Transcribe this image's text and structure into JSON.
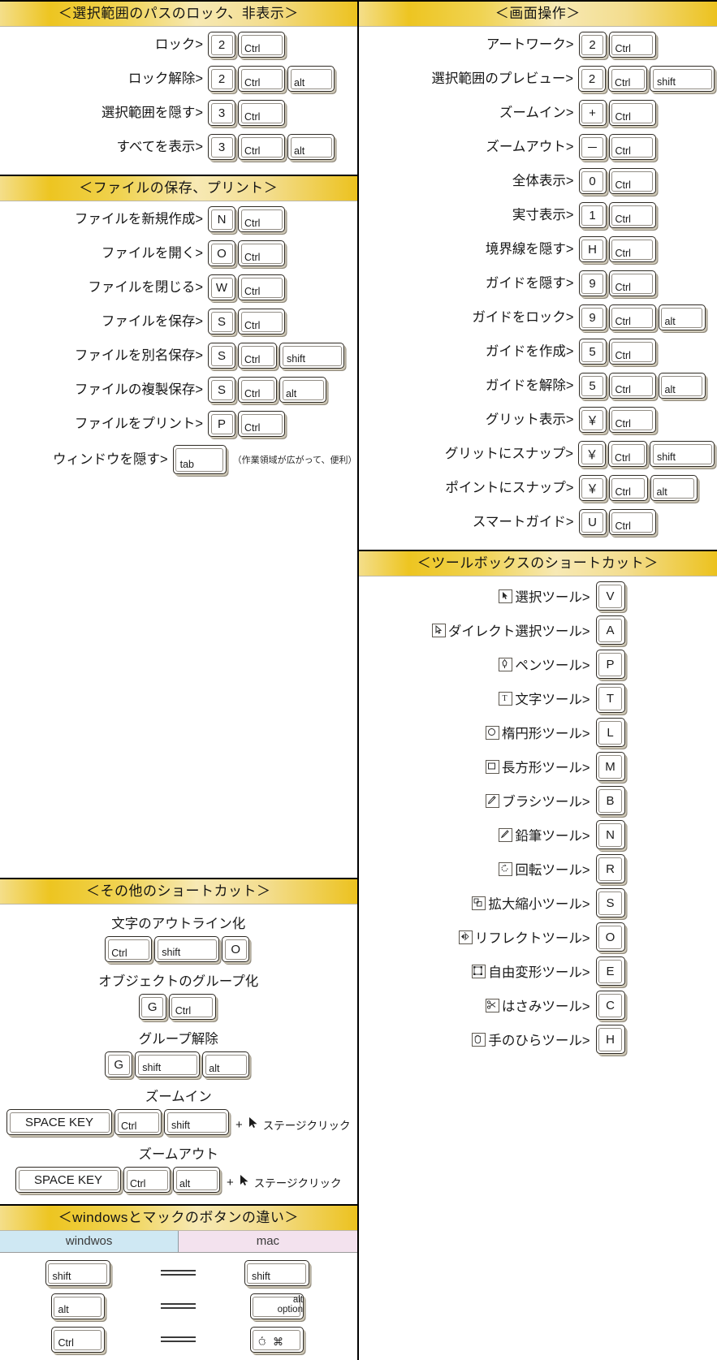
{
  "sections": {
    "lock_hide": {
      "title": "＜選択範囲のパスのロック、非表示＞",
      "rows": [
        {
          "label": "ロック>",
          "keys": [
            "2",
            "Ctrl"
          ]
        },
        {
          "label": "ロック解除>",
          "keys": [
            "2",
            "Ctrl",
            "alt"
          ]
        },
        {
          "label": "選択範囲を隠す>",
          "keys": [
            "3",
            "Ctrl"
          ]
        },
        {
          "label": "すべてを表示>",
          "keys": [
            "3",
            "Ctrl",
            "alt"
          ]
        }
      ]
    },
    "file_save_print": {
      "title": "＜ファイルの保存、プリント＞",
      "rows": [
        {
          "label": "ファイルを新規作成>",
          "keys": [
            "N",
            "Ctrl"
          ]
        },
        {
          "label": "ファイルを開く>",
          "keys": [
            "O",
            "Ctrl"
          ]
        },
        {
          "label": "ファイルを閉じる>",
          "keys": [
            "W",
            "Ctrl"
          ]
        },
        {
          "label": "ファイルを保存>",
          "keys": [
            "S",
            "Ctrl"
          ]
        },
        {
          "label": "ファイルを別名保存>",
          "keys": [
            "S",
            "Ctrl",
            "shift"
          ]
        },
        {
          "label": "ファイルの複製保存>",
          "keys": [
            "S",
            "Ctrl",
            "alt"
          ]
        },
        {
          "label": "ファイルをプリント>",
          "keys": [
            "P",
            "Ctrl"
          ]
        },
        {
          "label": "ウィンドウを隠す>",
          "keys": [
            "tab"
          ],
          "note": "（作業領域が広がって、便利）"
        }
      ]
    },
    "screen_ops": {
      "title": "＜画面操作＞",
      "rows": [
        {
          "label": "アートワーク>",
          "keys": [
            "2",
            "Ctrl"
          ]
        },
        {
          "label": "選択範囲のプレビュー>",
          "keys": [
            "2",
            "Ctrl",
            "shift"
          ]
        },
        {
          "label": "ズームイン>",
          "keys": [
            "+",
            "Ctrl"
          ]
        },
        {
          "label": "ズームアウト>",
          "keys": [
            "－",
            "Ctrl"
          ]
        },
        {
          "label": "全体表示>",
          "keys": [
            "0",
            "Ctrl"
          ]
        },
        {
          "label": "実寸表示>",
          "keys": [
            "1",
            "Ctrl"
          ]
        },
        {
          "label": "境界線を隠す>",
          "keys": [
            "H",
            "Ctrl"
          ]
        },
        {
          "label": "ガイドを隠す>",
          "keys": [
            "9",
            "Ctrl"
          ]
        },
        {
          "label": "ガイドをロック>",
          "keys": [
            "9",
            "Ctrl",
            "alt"
          ]
        },
        {
          "label": "ガイドを作成>",
          "keys": [
            "5",
            "Ctrl"
          ]
        },
        {
          "label": "ガイドを解除>",
          "keys": [
            "5",
            "Ctrl",
            "alt"
          ]
        },
        {
          "label": "グリット表示>",
          "keys": [
            "￥",
            "Ctrl"
          ]
        },
        {
          "label": "グリットにスナップ>",
          "keys": [
            "￥",
            "Ctrl",
            "shift"
          ]
        },
        {
          "label": "ポイントにスナップ>",
          "keys": [
            "￥",
            "Ctrl",
            "alt"
          ]
        },
        {
          "label": "スマートガイド>",
          "keys": [
            "U",
            "Ctrl"
          ]
        }
      ]
    },
    "other_shortcuts": {
      "title": "＜その他のショートカット＞",
      "groups": [
        {
          "caption": "文字のアウトライン化",
          "keys": [
            "Ctrl",
            "shift",
            "O"
          ]
        },
        {
          "caption": "オブジェクトのグループ化",
          "keys": [
            "G",
            "Ctrl"
          ]
        },
        {
          "caption": "グループ解除",
          "keys": [
            "G",
            "shift",
            "alt"
          ]
        },
        {
          "caption": "ズームイン",
          "keys": [
            "SPACE KEY",
            "Ctrl",
            "shift"
          ],
          "plus": "+",
          "click": "ステージクリック"
        },
        {
          "caption": "ズームアウト",
          "keys": [
            "SPACE KEY",
            "Ctrl",
            "alt"
          ],
          "plus": "+",
          "click": "ステージクリック"
        }
      ]
    },
    "win_mac": {
      "title": "＜windowsとマックのボタンの違い＞",
      "headers": {
        "windows": "windwos",
        "mac": "mac"
      },
      "rows": [
        {
          "windows": "shift",
          "mac": "shift",
          "mac_second": ""
        },
        {
          "windows": "alt",
          "mac": "alt",
          "mac_second": "option"
        },
        {
          "windows": "Ctrl",
          "mac": "⌘",
          "mac_second": ""
        }
      ]
    },
    "toolbox": {
      "title": "＜ツールボックスのショートカット＞",
      "rows": [
        {
          "icon": "selection-tool-icon",
          "label": "選択ツール>",
          "key": "V"
        },
        {
          "icon": "direct-selection-tool-icon",
          "label": "ダイレクト選択ツール>",
          "key": "A"
        },
        {
          "icon": "pen-tool-icon",
          "label": "ペンツール>",
          "key": "P"
        },
        {
          "icon": "type-tool-icon",
          "label": "文字ツール>",
          "key": "T"
        },
        {
          "icon": "ellipse-tool-icon",
          "label": "楕円形ツール>",
          "key": "L"
        },
        {
          "icon": "rectangle-tool-icon",
          "label": "長方形ツール>",
          "key": "M"
        },
        {
          "icon": "brush-tool-icon",
          "label": "ブラシツール>",
          "key": "B"
        },
        {
          "icon": "pencil-tool-icon",
          "label": "鉛筆ツール>",
          "key": "N"
        },
        {
          "icon": "rotate-tool-icon",
          "label": "回転ツール>",
          "key": "R"
        },
        {
          "icon": "scale-tool-icon",
          "label": "拡大縮小ツール>",
          "key": "S"
        },
        {
          "icon": "reflect-tool-icon",
          "label": "リフレクトツール>",
          "key": "O"
        },
        {
          "icon": "free-transform-tool-icon",
          "label": "自由変形ツール>",
          "key": "E"
        },
        {
          "icon": "scissors-tool-icon",
          "label": "はさみツール>",
          "key": "C"
        },
        {
          "icon": "hand-tool-icon",
          "label": "手のひらツール>",
          "key": "H"
        }
      ]
    }
  },
  "colors": {
    "header_gold": "#edc521",
    "header_light": "#f7e9b4",
    "win_blue": "#cfe8f3",
    "mac_pink": "#f3e2ee"
  }
}
